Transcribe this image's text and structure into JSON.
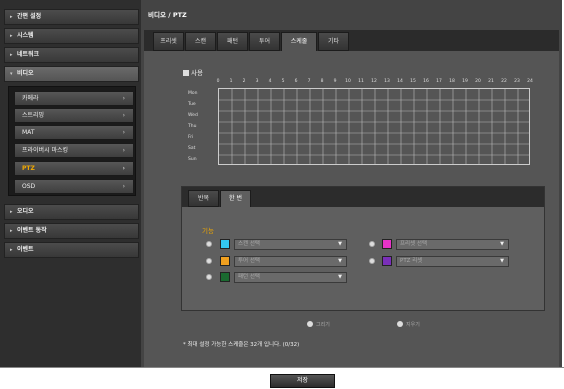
{
  "page_title": "비디오 / PTZ",
  "sidebar": {
    "items": [
      {
        "label": "간편 설정"
      },
      {
        "label": "시스템"
      },
      {
        "label": "네트워크"
      },
      {
        "label": "비디오"
      },
      {
        "label": "오디오"
      },
      {
        "label": "이벤트 동작"
      },
      {
        "label": "이벤트"
      }
    ],
    "video_sub": [
      {
        "label": "카메라"
      },
      {
        "label": "스트리밍"
      },
      {
        "label": "MAT"
      },
      {
        "label": "프라이버시 마스킹"
      },
      {
        "label": "PTZ"
      },
      {
        "label": "OSD"
      }
    ]
  },
  "tabs": [
    "프리셋",
    "스캔",
    "패턴",
    "투어",
    "스케줄",
    "기타"
  ],
  "schedule": {
    "label": "사용",
    "hours": [
      "0",
      "1",
      "2",
      "3",
      "4",
      "5",
      "6",
      "7",
      "8",
      "9",
      "10",
      "11",
      "12",
      "13",
      "14",
      "15",
      "16",
      "17",
      "18",
      "19",
      "20",
      "21",
      "22",
      "23",
      "24"
    ],
    "days": [
      "Mon",
      "Tue",
      "Wed",
      "Thu",
      "Fri",
      "Sat",
      "Sun"
    ]
  },
  "inner_tabs": [
    "반복",
    "한 번"
  ],
  "function_label": "기능",
  "functions": [
    {
      "label": "스캔 선택",
      "color": "#33c6f0"
    },
    {
      "label": "프리셋 선택",
      "color": "#e633c8"
    },
    {
      "label": "투어 선택",
      "color": "#f0a020"
    },
    {
      "label": "PTZ 리셋",
      "color": "#7a2fb8"
    },
    {
      "label": "패턴 선택",
      "color": "#1a6a30"
    }
  ],
  "draw_label": "그리기",
  "erase_label": "지우기",
  "note": "* 최대 설정 가능한 스케줄은 32개 입니다. (0/32)",
  "save_label": "저장"
}
